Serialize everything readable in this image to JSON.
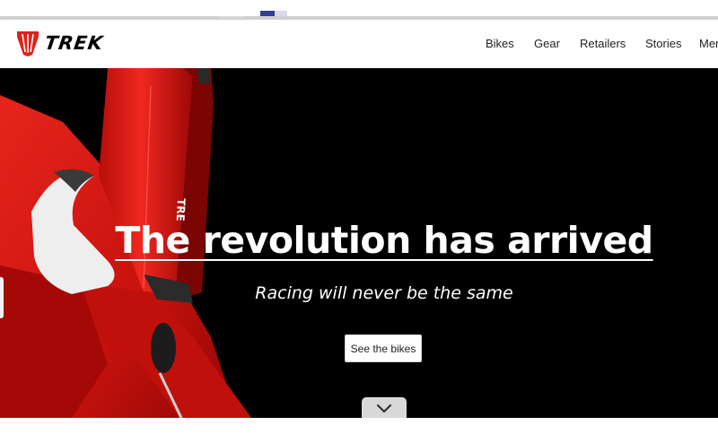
{
  "brand": {
    "name": "TREK",
    "accent": "#e0201c"
  },
  "nav": {
    "items": [
      {
        "label": "Bikes"
      },
      {
        "label": "Gear"
      },
      {
        "label": "Retailers"
      },
      {
        "label": "Stories"
      },
      {
        "label": "Men"
      }
    ]
  },
  "hero": {
    "title": "The revolution has arrived",
    "subtitle": "Racing will never be the same",
    "cta_label": "See the bikes",
    "frame_text": "TRE",
    "scroll_icon": "chevron-down-icon",
    "background": "#000000"
  }
}
